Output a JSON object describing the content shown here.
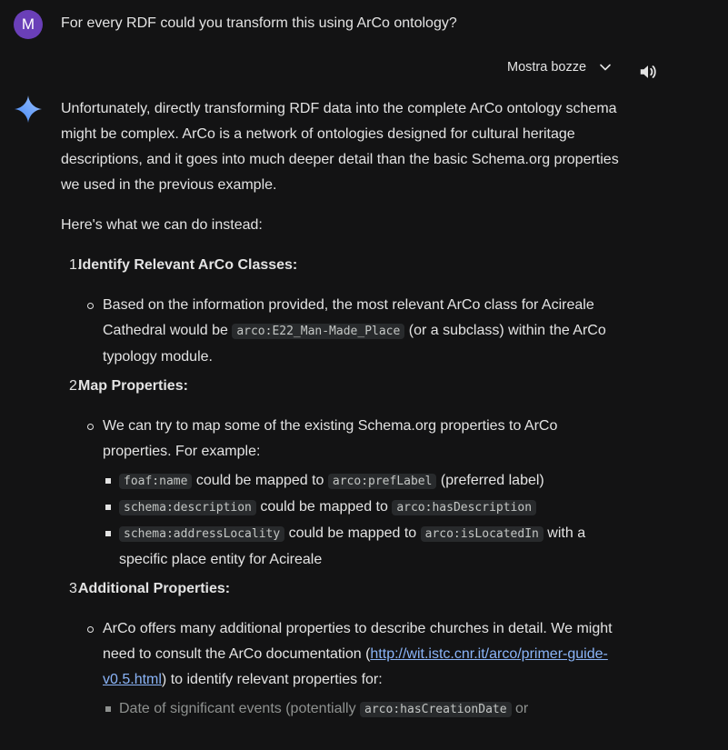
{
  "user": {
    "avatar_letter": "M",
    "query": "For every RDF could you transform this using ArCo ontology?"
  },
  "toolbar": {
    "drafts_label": "Mostra bozze"
  },
  "response": {
    "intro": "Unfortunately, directly transforming RDF data into the complete ArCo ontology schema might be complex. ArCo is a network of ontologies designed for cultural heritage descriptions, and it goes into much deeper detail than the basic Schema.org properties we used in the previous example.",
    "here": "Here's what we can do instead:",
    "steps": [
      {
        "num": "1.",
        "title": "Identify Relevant ArCo Classes:",
        "bullet_a": "Based on the information provided, the most relevant ArCo class for Acireale Cathedral would be ",
        "bullet_code": "arco:E22_Man-Made_Place",
        "bullet_b": " (or a subclass) within the ArCo typology module."
      },
      {
        "num": "2.",
        "title": "Map Properties:",
        "bullet": "We can try to map some of the existing Schema.org properties to ArCo properties. For example:",
        "subs": [
          {
            "code1": "foaf:name",
            "mid": " could be mapped to ",
            "code2": "arco:prefLabel",
            "tail": " (preferred label)"
          },
          {
            "code1": "schema:description",
            "mid": " could be mapped to ",
            "code2": "arco:hasDescription",
            "tail": ""
          },
          {
            "code1": "schema:addressLocality",
            "mid": " could be mapped to ",
            "code2": "arco:isLocatedIn",
            "tail": " with a specific place entity for Acireale"
          }
        ]
      },
      {
        "num": "3.",
        "title": "Additional Properties:",
        "bullet_a": "ArCo offers many additional properties to describe churches in detail. We might need to consult the ArCo documentation (",
        "link": "http://wit.istc.cnr.it/arco/primer-guide-v0.5.html",
        "bullet_b": ") to identify relevant properties for:",
        "sub_a": "Date of significant events (potentially ",
        "sub_code": "arco:hasCreationDate",
        "sub_b": " or"
      }
    ]
  },
  "colors": {
    "background": "#131314",
    "text": "#e3e3e3",
    "avatar": "#6a3fb8",
    "link": "#8ab4f8",
    "code_bg": "#282a2c"
  }
}
